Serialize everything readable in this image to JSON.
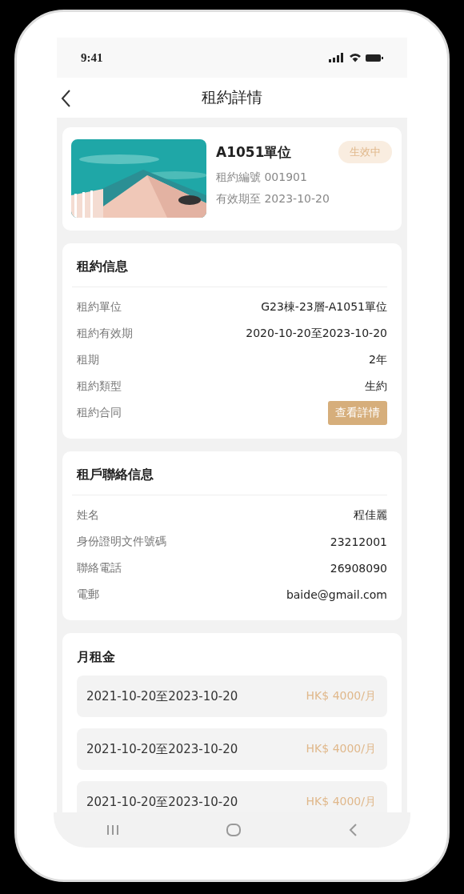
{
  "status_bar": {
    "time": "9:41"
  },
  "header": {
    "title": "租約詳情"
  },
  "lease_card": {
    "image": {
      "kind": "picture"
    },
    "unit": "A1051單位",
    "status": "生效中",
    "lines": [
      "租約編號 001901",
      "有效期至 2023-10-20"
    ]
  },
  "sections": [
    {
      "title": "租約信息",
      "rows": [
        {
          "kind": "text",
          "label": "租約單位",
          "value": "G23棟-23層-A1051單位"
        },
        {
          "kind": "text",
          "label": "租約有效期",
          "value": "2020-10-20至2023-10-20"
        },
        {
          "kind": "text",
          "label": "租期",
          "value": "2年"
        },
        {
          "kind": "text",
          "label": "租約類型",
          "value": "生約"
        },
        {
          "kind": "button",
          "label": "租約合同",
          "value": "查看詳情"
        }
      ]
    },
    {
      "title": "租戶聯絡信息",
      "rows": [
        {
          "kind": "text",
          "label": "姓名",
          "value": "程佳麗"
        },
        {
          "kind": "text",
          "label": "身份證明文件號碼",
          "value": "23212001"
        },
        {
          "kind": "text",
          "label": "聯絡電話",
          "value": "26908090"
        },
        {
          "kind": "text",
          "label": "電郵",
          "value": "baide@gmail.com"
        }
      ]
    }
  ],
  "monthly_rent": {
    "title": "月租金",
    "items": [
      {
        "period": "2021-10-20至2023-10-20",
        "amount": "HK$ 4000/月"
      },
      {
        "period": "2021-10-20至2023-10-20",
        "amount": "HK$ 4000/月"
      },
      {
        "period": "2021-10-20至2023-10-20",
        "amount": "HK$ 4000/月"
      }
    ]
  }
}
